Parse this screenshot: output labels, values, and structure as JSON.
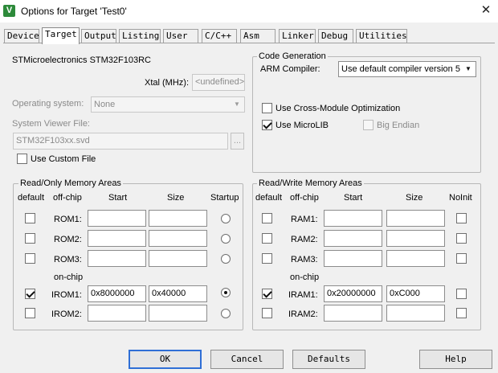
{
  "window": {
    "title": "Options for Target 'Test0'",
    "icon_letter": "V",
    "close_glyph": "✕"
  },
  "tabs": [
    {
      "label": "Device"
    },
    {
      "label": "Target"
    },
    {
      "label": "Output"
    },
    {
      "label": "Listing"
    },
    {
      "label": "User"
    },
    {
      "label": "C/C++"
    },
    {
      "label": "Asm"
    },
    {
      "label": "Linker"
    },
    {
      "label": "Debug"
    },
    {
      "label": "Utilities"
    }
  ],
  "active_tab": "Target",
  "device": {
    "name": "STMicroelectronics STM32F103RC",
    "xtal_label": "Xtal (MHz):",
    "xtal_value": "<undefined>",
    "os_label": "Operating system:",
    "os_value": "None",
    "svf_label": "System Viewer File:",
    "svf_value": "STM32F103xx.svd",
    "browse_label": "...",
    "custom_file_label": "Use Custom File",
    "custom_file_checked": false
  },
  "code_generation": {
    "title": "Code Generation",
    "compiler_label": "ARM Compiler:",
    "compiler_value": "Use default compiler version 5",
    "cross_module_label": "Use Cross-Module Optimization",
    "cross_module_checked": false,
    "microlib_label": "Use MicroLIB",
    "microlib_checked": true,
    "big_endian_label": "Big Endian",
    "big_endian_checked": false
  },
  "rom_area": {
    "title": "Read/Only Memory Areas",
    "headers": {
      "default": "default",
      "offchip": "off-chip",
      "start": "Start",
      "size": "Size",
      "last": "Startup"
    },
    "onchip_label": "on-chip",
    "rows": [
      {
        "name": "ROM1:",
        "start": "",
        "size": "",
        "default": false,
        "selected": false
      },
      {
        "name": "ROM2:",
        "start": "",
        "size": "",
        "default": false,
        "selected": false
      },
      {
        "name": "ROM3:",
        "start": "",
        "size": "",
        "default": false,
        "selected": false
      },
      {
        "name": "IROM1:",
        "start": "0x8000000",
        "size": "0x40000",
        "default": true,
        "selected": true
      },
      {
        "name": "IROM2:",
        "start": "",
        "size": "",
        "default": false,
        "selected": false
      }
    ]
  },
  "ram_area": {
    "title": "Read/Write Memory Areas",
    "headers": {
      "default": "default",
      "offchip": "off-chip",
      "start": "Start",
      "size": "Size",
      "last": "NoInit"
    },
    "onchip_label": "on-chip",
    "rows": [
      {
        "name": "RAM1:",
        "start": "",
        "size": "",
        "default": false,
        "noinit": false
      },
      {
        "name": "RAM2:",
        "start": "",
        "size": "",
        "default": false,
        "noinit": false
      },
      {
        "name": "RAM3:",
        "start": "",
        "size": "",
        "default": false,
        "noinit": false
      },
      {
        "name": "IRAM1:",
        "start": "0x20000000",
        "size": "0xC000",
        "default": true,
        "noinit": false
      },
      {
        "name": "IRAM2:",
        "start": "",
        "size": "",
        "default": false,
        "noinit": false
      }
    ]
  },
  "buttons": {
    "ok": "OK",
    "cancel": "Cancel",
    "defaults": "Defaults",
    "help": "Help"
  }
}
